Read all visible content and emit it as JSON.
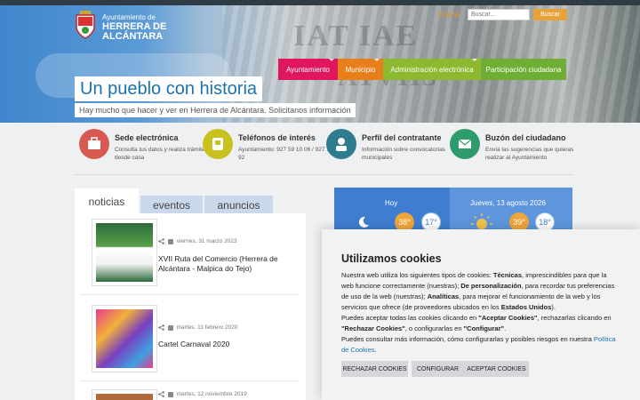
{
  "header": {
    "logo_small": "Ayuntamiento de",
    "logo_line1": "HERRERA DE",
    "logo_line2": "ALCÁNTARA",
    "search_label": "Buscar",
    "search_placeholder": "Buscar...",
    "search_button": "Buscar"
  },
  "nav": {
    "items": [
      {
        "label": "Ayuntamiento",
        "color": "#e0165f"
      },
      {
        "label": "Municipio",
        "color": "#e87f1b"
      },
      {
        "label": "Administración electrónica",
        "color": "#8cb92f"
      },
      {
        "label": "Participación ciudadana",
        "color": "#6fae35"
      }
    ]
  },
  "hero": {
    "title": "Un pueblo con historia",
    "subtitle": "Hay mucho que hacer y ver en Herrera de Alcántara. Solicitanos información"
  },
  "services": [
    {
      "title": "Sede electrónica",
      "desc": "Consulta tus datos y realiza trámites desde casa",
      "color": "#d95850",
      "icon": "briefcase-icon"
    },
    {
      "title": "Teléfonos de interés",
      "desc": "Ayuntamiento: 927 59 10 06 / 927 14 33 92",
      "color": "#c9c21e",
      "icon": "phone-icon"
    },
    {
      "title": "Perfil del contratante",
      "desc": "Información sobre convocatorias municipales",
      "color": "#2d7c8f",
      "icon": "user-icon"
    },
    {
      "title": "Buzón del ciudadano",
      "desc": "Envía las sugerencias que quieras realizar al Ayuntamiento",
      "color": "#2d9b6b",
      "icon": "envelope-icon"
    }
  ],
  "tabs": [
    {
      "label": "noticias"
    },
    {
      "label": "eventos"
    },
    {
      "label": "anuncios"
    }
  ],
  "news": [
    {
      "date": "viernes, 31 marzo 2023",
      "title": "XVII Ruta del Comercio (Herrera de Alcántara - Malpica do Tejo)"
    },
    {
      "date": "martes, 11 febrero 2020",
      "title": "Cartel Carnaval 2020"
    },
    {
      "date": "martes, 12 noviembre 2019",
      "title": ""
    }
  ],
  "weather": {
    "today_label": "Hoy",
    "today_max": "38°",
    "today_min": "17°",
    "tomorrow_label": "Jueves, 13 agosto 2026",
    "tomorrow_max": "39°",
    "tomorrow_min": "18°"
  },
  "cookie": {
    "title": "Utilizamos cookies",
    "p1_a": "Nuestra web utiliza los siguientes tipos de cookies: ",
    "p1_b": "Técnicas",
    "p1_c": ", imprescindibles para que la web funcione correctamente (nuestras); ",
    "p1_d": "De personalización",
    "p1_e": ", para recordar tus preferencias de uso de la web (nuestras); ",
    "p1_f": "Analíticas",
    "p1_g": ", para mejorar el funcionamiento de la web y los servicios que ofrece (de proveedores ubicados en los ",
    "p1_h": "Estados Unidos",
    "p1_i": ").",
    "p2_a": "Puedes aceptar todas las cookies clicando en ",
    "p2_b": "\"Aceptar Cookies\"",
    "p2_c": ", rechazarlas clicando en ",
    "p2_d": "\"Rechazar Cookies\"",
    "p2_e": ", o configurarlas en ",
    "p2_f": "\"Configurar\"",
    "p2_g": ".",
    "p3_a": "Puedes consultar más información, cómo configurarlas y posibles riesgos en nuestra ",
    "p3_link": "Política de Cookies",
    "p3_end": ".",
    "btn_reject": "RECHAZAR COOKIES",
    "btn_config": "CONFIGURAR",
    "btn_accept": "ACEPTAR COOKIES"
  }
}
